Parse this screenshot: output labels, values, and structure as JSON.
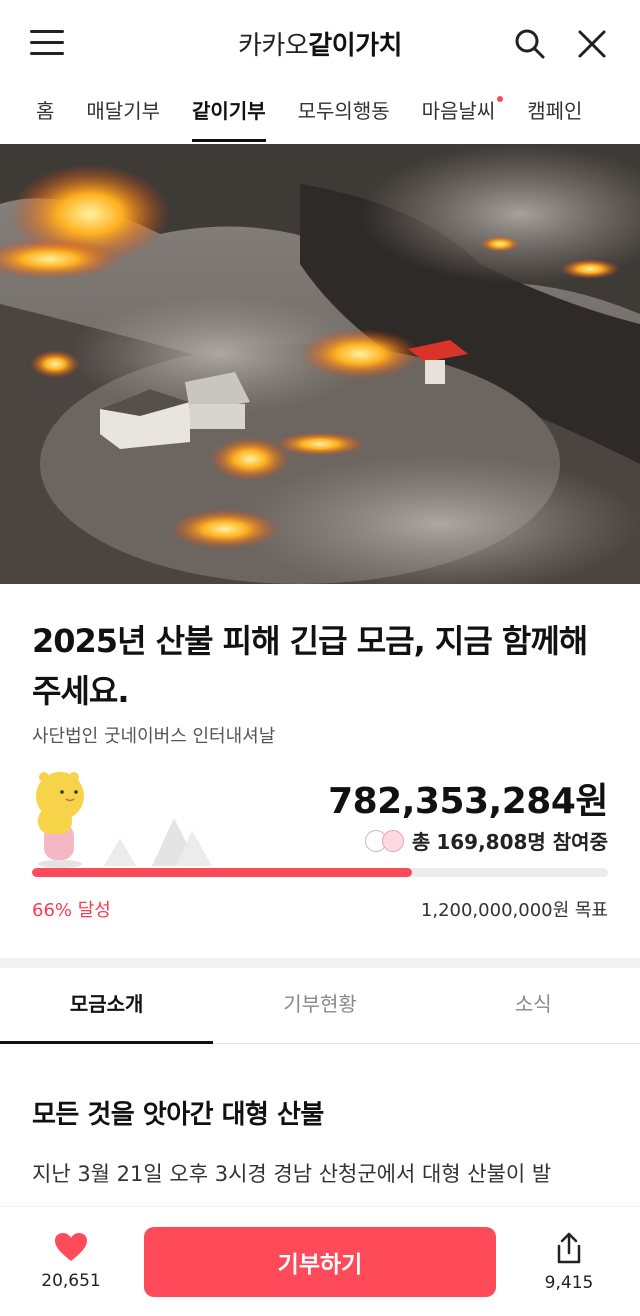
{
  "header": {
    "brand_prefix": "카카오",
    "brand_name": "같이가치"
  },
  "nav_tabs": [
    {
      "label": "홈"
    },
    {
      "label": "매달기부"
    },
    {
      "label": "같이기부",
      "active": true
    },
    {
      "label": "모두의행동"
    },
    {
      "label": "마음날씨",
      "new_dot": true
    },
    {
      "label": "캠페인"
    }
  ],
  "campaign": {
    "title": "2025년 산불 피해 긴급 모금, 지금 함께해 주세요.",
    "organization": "사단법인 굿네이버스 인터내셔날",
    "amount": "782,353,284원",
    "participants_label": "총",
    "participants_count": "169,808명 참여중",
    "progress_percent": 66,
    "achieved_text": "66% 달성",
    "goal_text": "1,200,000,000원 목표"
  },
  "sub_tabs": [
    {
      "label": "모금소개",
      "active": true
    },
    {
      "label": "기부현황"
    },
    {
      "label": "소식"
    }
  ],
  "content": {
    "section_title": "모든 것을 앗아간 대형 산불",
    "paragraph": "지난 3월 21일 오후 3시경 경남 산청군에서 대형 산불이 발"
  },
  "bottom_bar": {
    "like_count": "20,651",
    "donate_label": "기부하기",
    "share_count": "9,415"
  },
  "colors": {
    "accent": "#ff4a5a"
  },
  "icons": [
    "menu-icon",
    "search-icon",
    "close-icon",
    "heart-icon",
    "share-icon"
  ]
}
